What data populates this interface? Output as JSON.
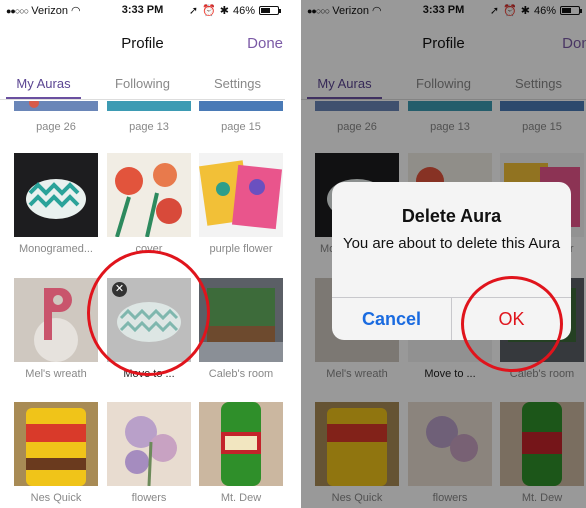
{
  "status": {
    "carrier": "Verizon",
    "time": "3:33 PM",
    "battery": "46%",
    "battery_level": 0.46
  },
  "nav": {
    "title": "Profile",
    "done_label": "Done"
  },
  "tabs": [
    {
      "label": "My Auras",
      "active": true
    },
    {
      "label": "Following",
      "active": false
    },
    {
      "label": "Settings",
      "active": false
    }
  ],
  "grid": [
    {
      "label": "page 26",
      "thumb": "colorful-art"
    },
    {
      "label": "page 13",
      "thumb": "colorful-art"
    },
    {
      "label": "page 15",
      "thumb": "colorful-art"
    },
    {
      "label": "Monogramed...",
      "thumb": "chevron-hat"
    },
    {
      "label": "cover",
      "thumb": "floral-cover"
    },
    {
      "label": "purple flower",
      "thumb": "purple-flower-drawing"
    },
    {
      "label": "Mel's wreath",
      "thumb": "pink-letter-wreath"
    },
    {
      "label": "Move to ...",
      "thumb": "chevron-pattern"
    },
    {
      "label": "Caleb's room",
      "thumb": "minecraft-poster"
    },
    {
      "label": "Nes Quick",
      "thumb": "nesquik-can"
    },
    {
      "label": "flowers",
      "thumb": "flower-painting"
    },
    {
      "label": "Mt. Dew",
      "thumb": "mountain-dew-bottle"
    }
  ],
  "alert": {
    "title": "Delete Aura",
    "message": "You are about to delete this Aura",
    "cancel_label": "Cancel",
    "ok_label": "OK"
  },
  "colors": {
    "accent": "#6a50a0",
    "alert_cancel": "#1a6be0",
    "alert_ok": "#e0141c",
    "highlight_circle": "#e0141c"
  }
}
